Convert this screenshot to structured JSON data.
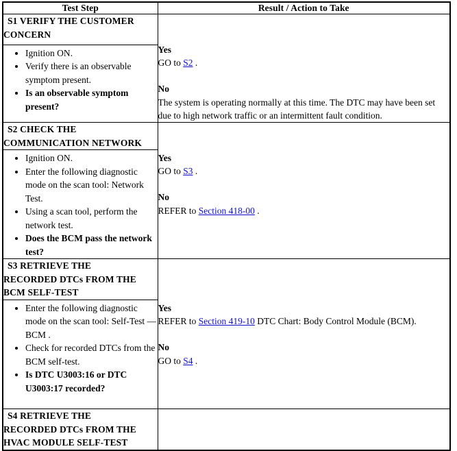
{
  "table": {
    "headers": {
      "test_step": "Test Step",
      "result_action": "Result / Action to Take"
    },
    "link_color": "#1111cc",
    "border_color": "#000000",
    "background": "#ffffff"
  },
  "steps": [
    {
      "id": "S1",
      "title": "S1 VERIFY THE CUSTOMER CONCERN",
      "title_line1": "S1 VERIFY THE CUSTOMER",
      "title_line2": "CONCERN",
      "bullets": [
        {
          "text": "Ignition ON.",
          "bold": false
        },
        {
          "text": "Verify there is an observable symptom present.",
          "bold": false
        },
        {
          "text": "Is an observable symptom present?",
          "bold": true
        }
      ],
      "results": [
        {
          "label": "Yes",
          "prefix": "GO to ",
          "link": "S2",
          "suffix": " ."
        },
        {
          "label": "No",
          "prefix": "The system is operating normally at this time. The DTC may have been set due to high network traffic or an intermittent fault condition.",
          "link": "",
          "suffix": ""
        }
      ]
    },
    {
      "id": "S2",
      "title": "S2 CHECK THE COMMUNICATION NETWORK",
      "title_line1": "S2 CHECK THE",
      "title_line2": "COMMUNICATION NETWORK",
      "bullets": [
        {
          "text": "Ignition ON.",
          "bold": false
        },
        {
          "text": "Enter the following diagnostic mode on the scan tool: Network Test.",
          "bold": false
        },
        {
          "text": "Using a scan tool, perform the network test.",
          "bold": false
        },
        {
          "text": "Does the BCM pass the network test?",
          "bold": true
        }
      ],
      "results": [
        {
          "label": "Yes",
          "prefix": "GO to ",
          "link": "S3",
          "suffix": " ."
        },
        {
          "label": "No",
          "prefix": "REFER to ",
          "link": "Section 418-00",
          "suffix": " ."
        }
      ]
    },
    {
      "id": "S3",
      "title": "S3 RETRIEVE THE RECORDED DTCs FROM THE BCM SELF-TEST",
      "title_line1": "S3 RETRIEVE THE",
      "title_line2": "RECORDED DTCs FROM THE",
      "title_line3": "BCM SELF-TEST",
      "bullets": [
        {
          "text": "Enter the following diagnostic mode on the scan tool: Self-Test — BCM .",
          "bold": false
        },
        {
          "text": "Check for recorded DTCs from the BCM self-test.",
          "bold": false
        },
        {
          "text": "Is DTC U3003:16 or DTC U3003:17 recorded?",
          "bold": true
        }
      ],
      "results": [
        {
          "label": "Yes",
          "prefix": "REFER to ",
          "link": "Section 419-10",
          "suffix": " DTC Chart: Body Control Module (BCM)."
        },
        {
          "label": "No",
          "prefix": "GO to ",
          "link": "S4",
          "suffix": " ."
        }
      ]
    },
    {
      "id": "S4",
      "title": "S4 RETRIEVE THE RECORDED DTCs FROM THE HVAC MODULE SELF-TEST",
      "title_line1": "S4 RETRIEVE THE",
      "title_line2": "RECORDED DTCs FROM THE",
      "title_line3": "HVAC MODULE SELF-TEST",
      "bullets": [],
      "results": []
    }
  ]
}
